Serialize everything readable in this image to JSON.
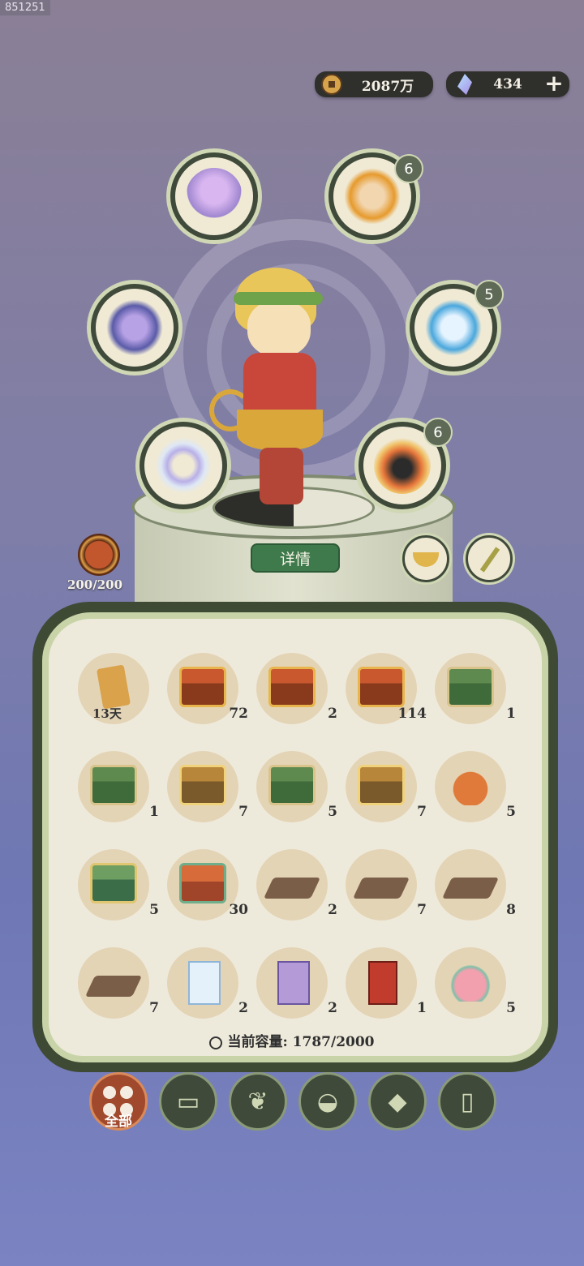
{
  "device_id": "851251",
  "currency": {
    "coins": "2087万",
    "gems": "434",
    "add_icon": "plus-icon"
  },
  "equipment": [
    {
      "name": "lotus-lamp",
      "badge": null
    },
    {
      "name": "fire-spirit-portrait",
      "badge": "6"
    },
    {
      "name": "crystal-armor",
      "badge": null
    },
    {
      "name": "ice-spirit-portrait",
      "badge": "5"
    },
    {
      "name": "spirit-bracelet",
      "badge": null
    },
    {
      "name": "phoenix-bird-portrait",
      "badge": "6"
    }
  ],
  "stamina": {
    "value": "200/200"
  },
  "detail_button": "详情",
  "inventory": {
    "items": [
      {
        "icon": "scroll",
        "count": "13天"
      },
      {
        "icon": "red-chest",
        "count": "72"
      },
      {
        "icon": "red-chest-books",
        "count": "2"
      },
      {
        "icon": "red-chest-books",
        "count": "114"
      },
      {
        "icon": "green-chest",
        "count": "1"
      },
      {
        "icon": "green-chest",
        "count": "1"
      },
      {
        "icon": "gold-chest",
        "count": "7"
      },
      {
        "icon": "green-chest",
        "count": "5"
      },
      {
        "icon": "gold-chest",
        "count": "7"
      },
      {
        "icon": "orange-pouch",
        "count": "5"
      },
      {
        "icon": "palm-chest",
        "count": "5"
      },
      {
        "icon": "shrine-chest",
        "count": "30"
      },
      {
        "icon": "spoon-board",
        "count": "2"
      },
      {
        "icon": "spoon-board",
        "count": "7"
      },
      {
        "icon": "spoon-board",
        "count": "8"
      },
      {
        "icon": "spoon-board",
        "count": "7"
      },
      {
        "icon": "blue-talisman",
        "count": "2"
      },
      {
        "icon": "purple-talisman",
        "count": "2"
      },
      {
        "icon": "red-talisman",
        "count": "1"
      },
      {
        "icon": "pink-lotus",
        "count": "5"
      }
    ],
    "capacity_label": "当前容量:",
    "capacity_value": "1787/2000"
  },
  "tabs": [
    {
      "label": "全部",
      "icon": "all-grid-icon",
      "active": true
    },
    {
      "label": "",
      "icon": "wood-log-icon"
    },
    {
      "label": "",
      "icon": "herb-icon"
    },
    {
      "label": "",
      "icon": "rice-bowl-icon"
    },
    {
      "label": "",
      "icon": "ore-icon"
    },
    {
      "label": "",
      "icon": "scroll-icon"
    }
  ]
}
